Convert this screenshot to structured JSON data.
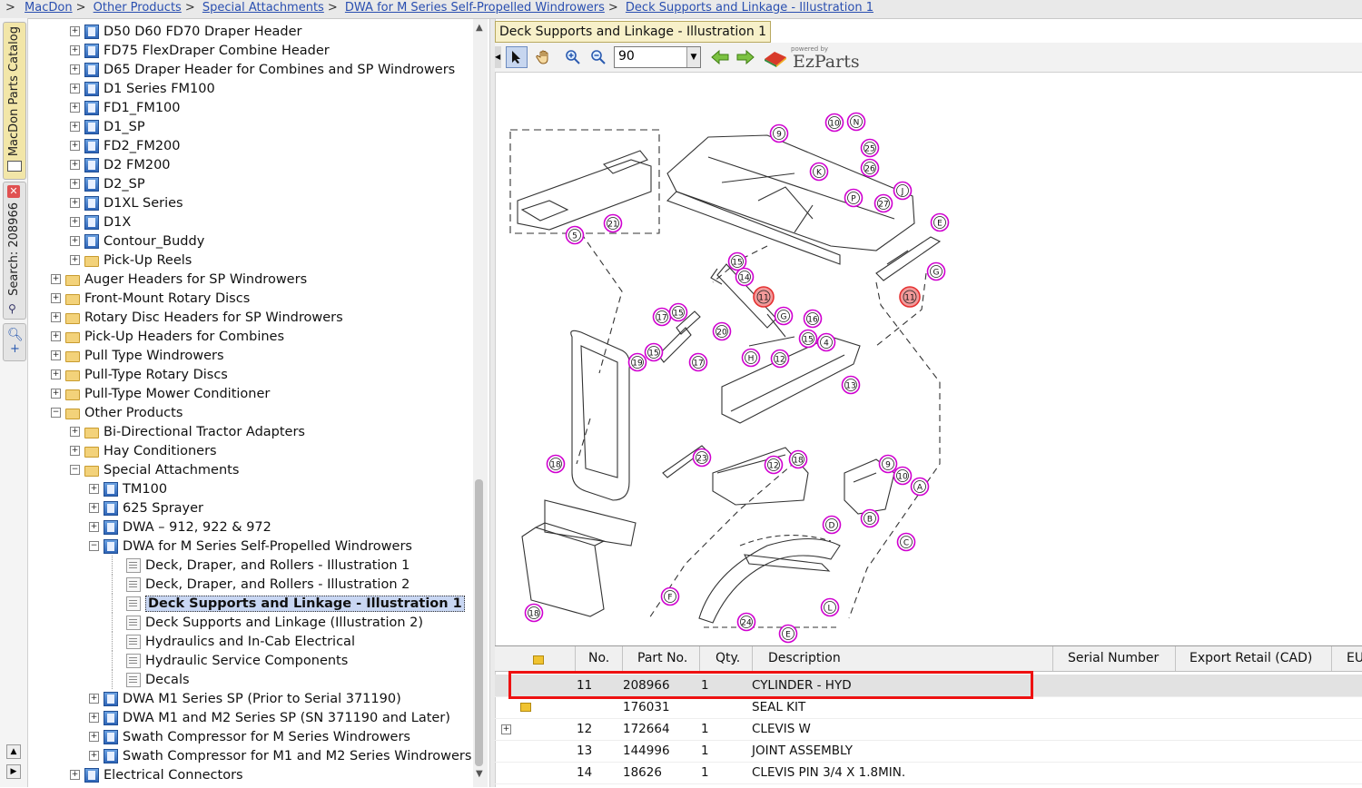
{
  "breadcrumb": {
    "root": ">",
    "items": [
      "MacDon",
      "Other Products",
      "Special Attachments",
      "DWA for M Series Self-Propelled Windrowers",
      "Deck Supports and Linkage - Illustration 1"
    ]
  },
  "side_tabs": {
    "catalog": "MacDon Parts Catalog",
    "search": "Search: 208966"
  },
  "tree": [
    {
      "label": "D50 D60 FD70 Draper Header",
      "icon": "book",
      "level": 1
    },
    {
      "label": "FD75 FlexDraper Combine Header",
      "icon": "book",
      "level": 1
    },
    {
      "label": "D65 Draper Header for Combines and SP Windrowers",
      "icon": "book",
      "level": 1
    },
    {
      "label": "D1 Series FM100",
      "icon": "book",
      "level": 1
    },
    {
      "label": "FD1_FM100",
      "icon": "book",
      "level": 1
    },
    {
      "label": "D1_SP",
      "icon": "book",
      "level": 1
    },
    {
      "label": "FD2_FM200",
      "icon": "book",
      "level": 1
    },
    {
      "label": "D2 FM200",
      "icon": "book",
      "level": 1
    },
    {
      "label": "D2_SP",
      "icon": "book",
      "level": 1
    },
    {
      "label": "D1XL Series",
      "icon": "book",
      "level": 1
    },
    {
      "label": "D1X",
      "icon": "book",
      "level": 1
    },
    {
      "label": "Contour_Buddy",
      "icon": "book",
      "level": 1
    },
    {
      "label": "Pick-Up Reels",
      "icon": "folder",
      "level": 1
    },
    {
      "label": "Auger Headers for SP Windrowers",
      "icon": "folder",
      "level": 0
    },
    {
      "label": "Front-Mount Rotary Discs",
      "icon": "folder",
      "level": 0
    },
    {
      "label": "Rotary Disc Headers for SP Windrowers",
      "icon": "folder",
      "level": 0
    },
    {
      "label": "Pick-Up Headers for Combines",
      "icon": "folder",
      "level": 0
    },
    {
      "label": "Pull Type Windrowers",
      "icon": "folder",
      "level": 0
    },
    {
      "label": "Pull-Type Rotary Discs",
      "icon": "folder",
      "level": 0
    },
    {
      "label": "Pull-Type Mower Conditioner",
      "icon": "folder",
      "level": 0
    },
    {
      "label": "Other Products",
      "icon": "folder",
      "level": 0,
      "expanded": true
    },
    {
      "label": "Bi-Directional Tractor Adapters",
      "icon": "folder",
      "level": 1
    },
    {
      "label": "Hay Conditioners",
      "icon": "folder",
      "level": 1
    },
    {
      "label": "Special Attachments",
      "icon": "folder",
      "level": 1,
      "expanded": true
    },
    {
      "label": "TM100",
      "icon": "book",
      "level": 2
    },
    {
      "label": "625 Sprayer",
      "icon": "book",
      "level": 2
    },
    {
      "label": "DWA – 912, 922 & 972",
      "icon": "book",
      "level": 2
    },
    {
      "label": "DWA for M Series Self-Propelled Windrowers",
      "icon": "book",
      "level": 2,
      "expanded": true
    },
    {
      "label": "Deck, Draper, and Rollers - Illustration 1",
      "icon": "page",
      "level": 3,
      "leaf": true
    },
    {
      "label": "Deck, Draper, and Rollers - Illustration 2",
      "icon": "page",
      "level": 3,
      "leaf": true
    },
    {
      "label": "Deck Supports and Linkage - Illustration 1",
      "icon": "page",
      "level": 3,
      "leaf": true,
      "selected": true
    },
    {
      "label": "Deck Supports and Linkage (Illustration 2)",
      "icon": "page",
      "level": 3,
      "leaf": true
    },
    {
      "label": "Hydraulics and In-Cab Electrical",
      "icon": "page",
      "level": 3,
      "leaf": true
    },
    {
      "label": "Hydraulic Service Components",
      "icon": "page",
      "level": 3,
      "leaf": true
    },
    {
      "label": "Decals",
      "icon": "page",
      "level": 3,
      "leaf": true
    },
    {
      "label": "DWA M1 Series SP  (Prior to Serial 371190)",
      "icon": "book",
      "level": 2
    },
    {
      "label": "DWA M1 and M2 Series SP (SN 371190 and Later)",
      "icon": "book",
      "level": 2
    },
    {
      "label": "Swath Compressor for M Series Windrowers",
      "icon": "book",
      "level": 2
    },
    {
      "label": "Swath Compressor for M1 and M2 Series Windrowers",
      "icon": "book",
      "level": 2
    },
    {
      "label": "Electrical Connectors",
      "icon": "book",
      "level": 1
    }
  ],
  "viewer": {
    "tab_title": "Deck Supports and Linkage - Illustration 1",
    "zoom": "90",
    "brand_powered": "powered by",
    "brand_name": "EzParts",
    "toolbar_icons": [
      "select-arrow-icon",
      "pan-hand-icon",
      "zoom-in-icon",
      "zoom-out-icon",
      "back-arrow-icon",
      "forward-arrow-icon"
    ]
  },
  "callouts": [
    {
      "t": "9",
      "hl": false
    },
    {
      "t": "10",
      "hl": false
    },
    {
      "t": "N",
      "hl": false
    },
    {
      "t": "25",
      "hl": false
    },
    {
      "t": "K",
      "hl": false
    },
    {
      "t": "26",
      "hl": false
    },
    {
      "t": "J",
      "hl": false
    },
    {
      "t": "P",
      "hl": false
    },
    {
      "t": "27",
      "hl": false
    },
    {
      "t": "E",
      "hl": false
    },
    {
      "t": "G",
      "hl": false
    },
    {
      "t": "11",
      "hl": true
    },
    {
      "t": "5",
      "hl": false
    },
    {
      "t": "21",
      "hl": false
    },
    {
      "t": "15",
      "hl": false
    },
    {
      "t": "14",
      "hl": false
    },
    {
      "t": "11",
      "hl": true
    },
    {
      "t": "17",
      "hl": false
    },
    {
      "t": "15",
      "hl": false
    },
    {
      "t": "G",
      "hl": false
    },
    {
      "t": "16",
      "hl": false
    },
    {
      "t": "20",
      "hl": false
    },
    {
      "t": "15",
      "hl": false
    },
    {
      "t": "4",
      "hl": false
    },
    {
      "t": "15",
      "hl": false
    },
    {
      "t": "19",
      "hl": false
    },
    {
      "t": "H",
      "hl": false
    },
    {
      "t": "12",
      "hl": false
    },
    {
      "t": "17",
      "hl": false
    },
    {
      "t": "13",
      "hl": false
    },
    {
      "t": "18",
      "hl": false
    },
    {
      "t": "23",
      "hl": false
    },
    {
      "t": "12",
      "hl": false
    },
    {
      "t": "18",
      "hl": false
    },
    {
      "t": "9",
      "hl": false
    },
    {
      "t": "10",
      "hl": false
    },
    {
      "t": "A",
      "hl": false
    },
    {
      "t": "D",
      "hl": false
    },
    {
      "t": "B",
      "hl": false
    },
    {
      "t": "C",
      "hl": false
    },
    {
      "t": "F",
      "hl": false
    },
    {
      "t": "L",
      "hl": false
    },
    {
      "t": "18",
      "hl": false
    },
    {
      "t": "24",
      "hl": false
    },
    {
      "t": "E",
      "hl": false
    },
    {
      "t": "G",
      "hl": false
    },
    {
      "t": "M",
      "hl": false
    },
    {
      "t": "E",
      "hl": false
    },
    {
      "t": "8",
      "hl": false
    }
  ],
  "parts_grid": {
    "columns": [
      "",
      "No.",
      "Part No.",
      "Qty.",
      "Description",
      "Serial Number",
      "Export Retail (CAD)",
      "EU"
    ],
    "rows": [
      {
        "icon": "",
        "no": "11",
        "part": "208966",
        "qty": "1",
        "desc": "CYLINDER - HYD",
        "selected": true
      },
      {
        "icon": "kit-icon",
        "no": "",
        "part": "176031",
        "qty": "",
        "desc": "SEAL KIT"
      },
      {
        "icon": "expand-icon",
        "no": "12",
        "part": "172664",
        "qty": "1",
        "desc": "CLEVIS W"
      },
      {
        "icon": "",
        "no": "13",
        "part": "144996",
        "qty": "1",
        "desc": "JOINT ASSEMBLY"
      },
      {
        "icon": "",
        "no": "14",
        "part": "18626",
        "qty": "1",
        "desc": "CLEVIS PIN 3/4 X 1.8MIN."
      }
    ]
  },
  "colors": {
    "callout": "#d000d0",
    "callout_highlight": "#e53030",
    "selection_box": "#ee1111",
    "link": "#2a4fb0"
  }
}
